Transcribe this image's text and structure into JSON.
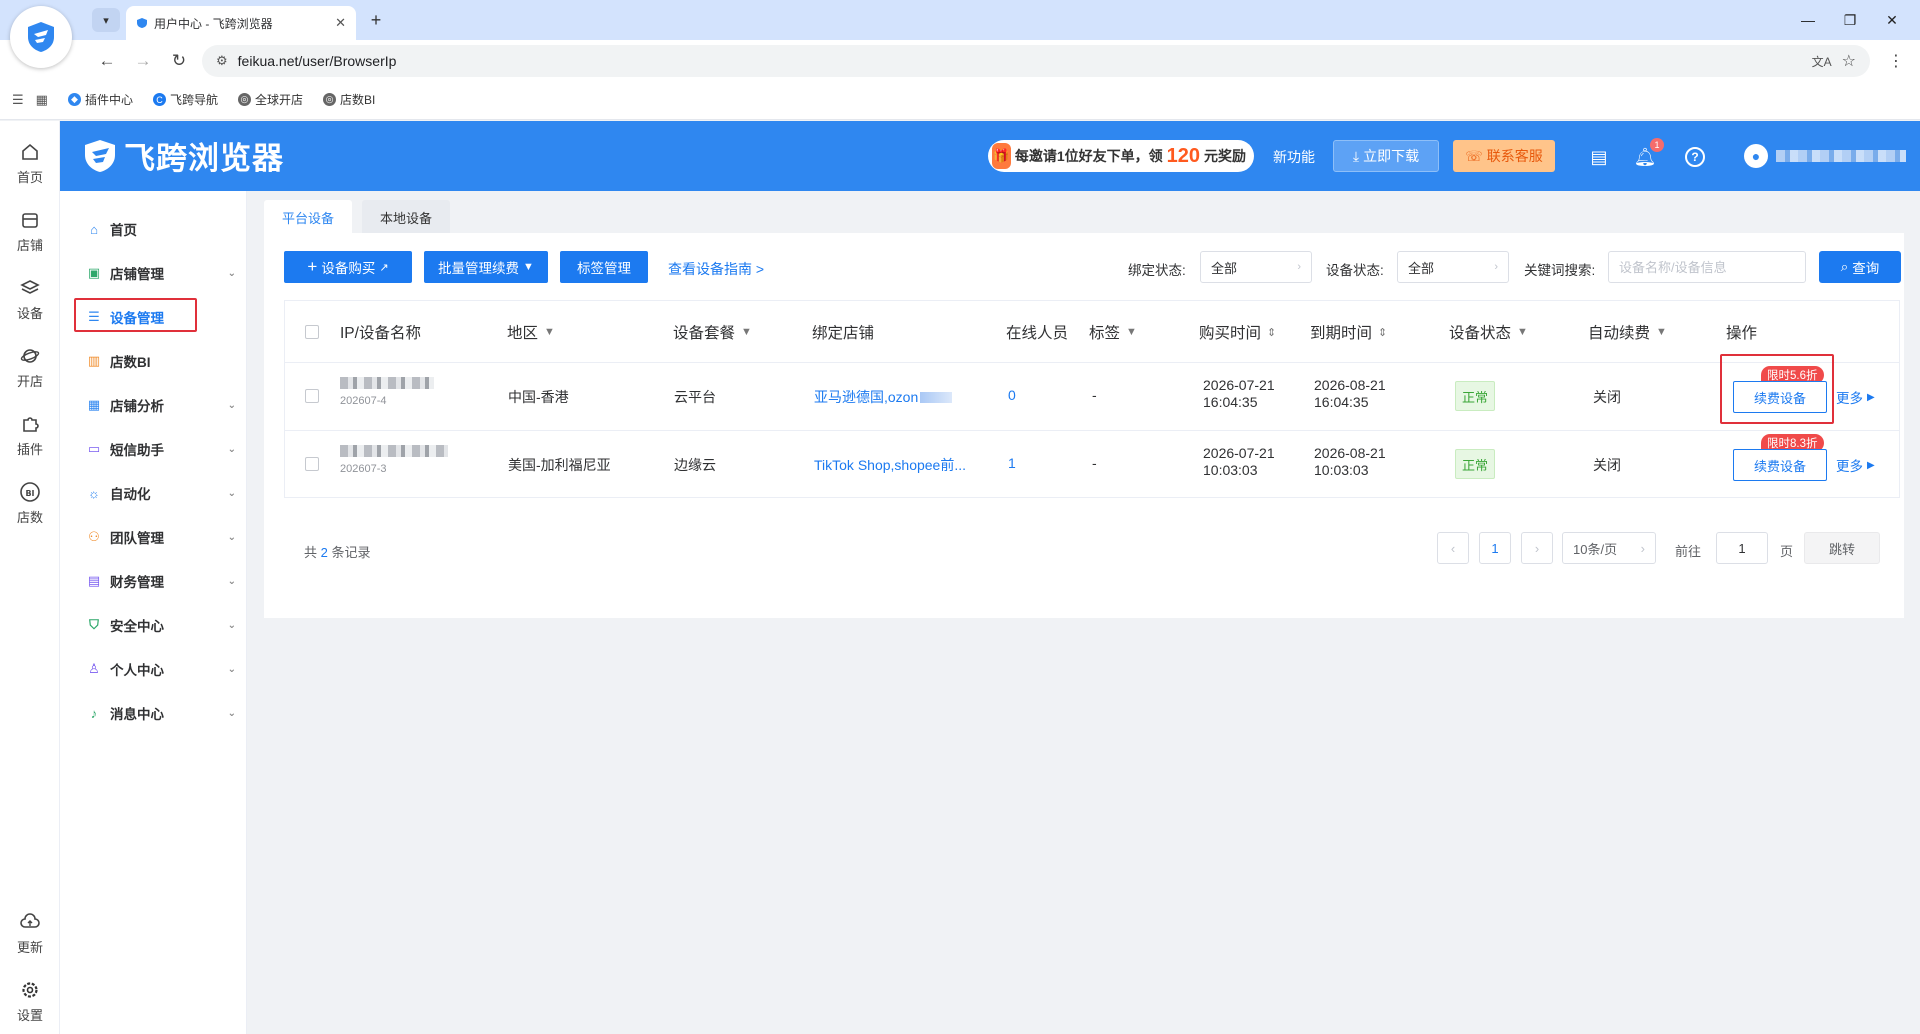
{
  "browser": {
    "tab_title": "用户中心 - 飞跨浏览器",
    "url": "feikua.net/user/BrowserIp",
    "bookmarks": [
      {
        "label": "插件中心",
        "icon": "shield-icon"
      },
      {
        "label": "飞跨导航",
        "icon": "c-logo-icon"
      },
      {
        "label": "全球开店",
        "icon": "globe-icon"
      },
      {
        "label": "店数BI",
        "icon": "globe-icon"
      }
    ]
  },
  "header": {
    "logo_text": "飞跨浏览器",
    "promo_prefix": "每邀请1位好友下单，领",
    "promo_number": "120",
    "promo_suffix": "元奖励",
    "new_feature": "新功能",
    "download_label": "立即下载",
    "service_label": "联系客服",
    "notification_count": "1"
  },
  "rail": [
    {
      "label": "首页",
      "icon": "home-icon"
    },
    {
      "label": "店铺",
      "icon": "store-icon"
    },
    {
      "label": "设备",
      "icon": "layers-icon"
    },
    {
      "label": "开店",
      "icon": "globe-icon"
    },
    {
      "label": "插件",
      "icon": "puzzle-icon"
    },
    {
      "label": "店数",
      "icon": "bi-icon"
    },
    {
      "label": "更新",
      "icon": "cloud-upload-icon"
    },
    {
      "label": "设置",
      "icon": "gear-icon"
    }
  ],
  "sidebar": {
    "items": [
      {
        "label": "首页",
        "icon": "home-icon",
        "expandable": false
      },
      {
        "label": "店铺管理",
        "icon": "store-icon",
        "expandable": true
      },
      {
        "label": "设备管理",
        "icon": "server-icon",
        "expandable": false,
        "active": true
      },
      {
        "label": "店数BI",
        "icon": "bar-chart-icon",
        "expandable": false
      },
      {
        "label": "店铺分析",
        "icon": "grid-icon",
        "expandable": true
      },
      {
        "label": "短信助手",
        "icon": "message-icon",
        "expandable": true
      },
      {
        "label": "自动化",
        "icon": "sun-icon",
        "expandable": true
      },
      {
        "label": "团队管理",
        "icon": "team-icon",
        "expandable": true
      },
      {
        "label": "财务管理",
        "icon": "wallet-icon",
        "expandable": true
      },
      {
        "label": "安全中心",
        "icon": "shield-check-icon",
        "expandable": true
      },
      {
        "label": "个人中心",
        "icon": "user-icon",
        "expandable": true
      },
      {
        "label": "消息中心",
        "icon": "bell-icon",
        "expandable": true
      }
    ]
  },
  "tabs": [
    "平台设备",
    "本地设备"
  ],
  "toolbar": {
    "buy_label": "设备购买",
    "batch_label": "批量管理续费",
    "tag_label": "标签管理",
    "guide_label": "查看设备指南 >",
    "bind_status_label": "绑定状态:",
    "bind_status_value": "全部",
    "device_status_label": "设备状态:",
    "device_status_value": "全部",
    "keyword_label": "关键词搜索:",
    "keyword_placeholder": "设备名称/设备信息",
    "search_label": "查询"
  },
  "table": {
    "columns": [
      "IP/设备名称",
      "地区",
      "设备套餐",
      "绑定店铺",
      "在线人员",
      "标签",
      "购买时间",
      "到期时间",
      "设备状态",
      "自动续费",
      "操作"
    ],
    "rows": [
      {
        "device_sub": "202607-4",
        "region": "中国-香港",
        "plan": "云平台",
        "store": "亚马逊德国,ozon",
        "online": "0",
        "tag": "-",
        "buy_date": "2026-07-21",
        "buy_time": "16:04:35",
        "expire_date": "2026-08-21",
        "expire_time": "16:04:35",
        "status": "正常",
        "auto_renew": "关闭",
        "discount": "限时5.6折",
        "renew_label": "续费设备",
        "more_label": "更多"
      },
      {
        "device_sub": "202607-3",
        "region": "美国-加利福尼亚",
        "plan": "边缘云",
        "store": "TikTok Shop,shopee前...",
        "online": "1",
        "tag": "-",
        "buy_date": "2026-07-21",
        "buy_time": "10:03:03",
        "expire_date": "2026-08-21",
        "expire_time": "10:03:03",
        "status": "正常",
        "auto_renew": "关闭",
        "discount": "限时8.3折",
        "renew_label": "续费设备",
        "more_label": "更多"
      }
    ]
  },
  "pagination": {
    "total_prefix": "共",
    "total_count": "2",
    "total_suffix": "条记录",
    "current_page": "1",
    "page_size": "10条/页",
    "goto_label": "前往",
    "goto_value": "1",
    "page_unit": "页",
    "jump_label": "跳转"
  },
  "colors": {
    "primary": "#1c7af0",
    "header": "#2f87f0",
    "highlight": "#e0303a",
    "success": "#3aa637"
  }
}
